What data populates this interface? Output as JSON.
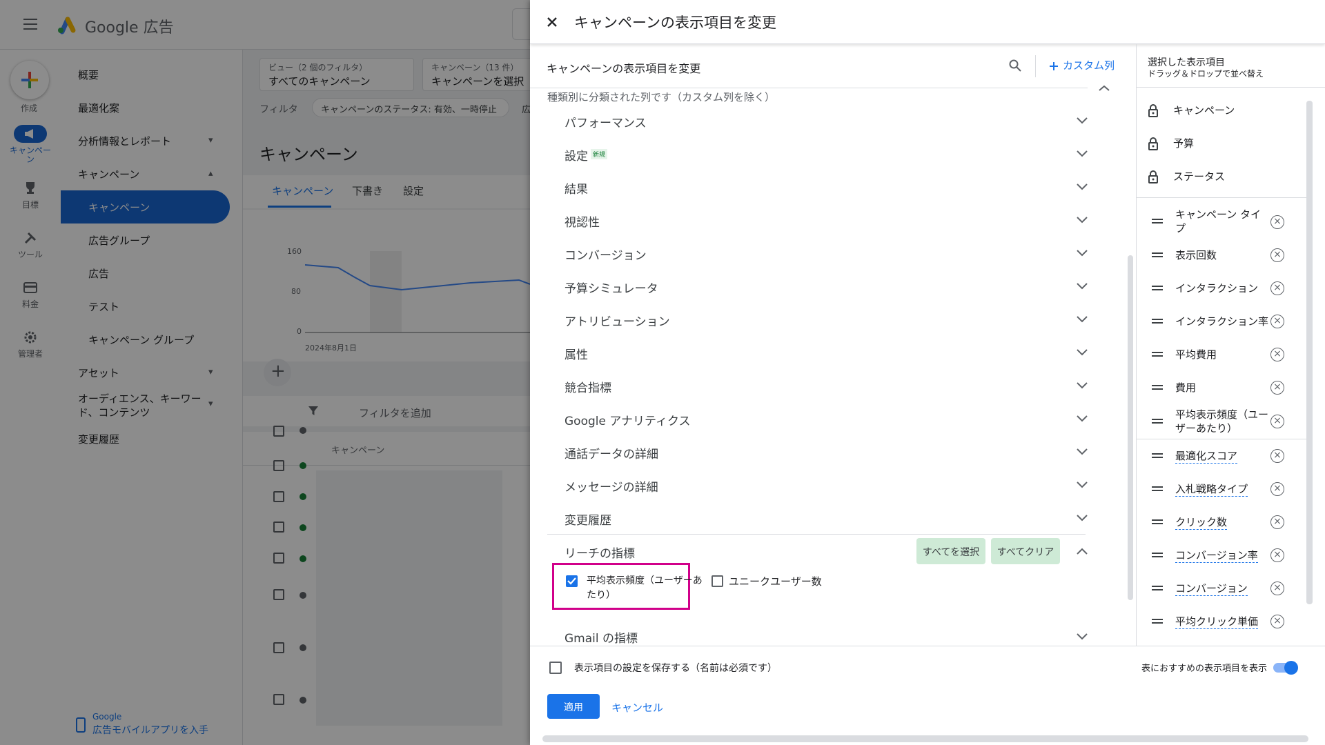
{
  "app": {
    "logo_text": "Google 広告",
    "create_label": "作成",
    "rail": [
      {
        "icon": "campaign-megaphone-icon",
        "label": "キャンペーン"
      },
      {
        "icon": "trophy-icon",
        "label": "目標"
      },
      {
        "icon": "tools-icon",
        "label": "ツール"
      },
      {
        "icon": "billing-card-icon",
        "label": "料金"
      },
      {
        "icon": "gear-icon",
        "label": "管理者"
      }
    ],
    "nav": {
      "overview": "概要",
      "recommendations": "最適化案",
      "insights": "分析情報とレポート",
      "campaigns": "キャンペーン",
      "campaigns_sub": [
        "キャンペーン",
        "広告グループ",
        "広告",
        "テスト",
        "キャンペーン グループ"
      ],
      "assets": "アセット",
      "audiences": "オーディエンス、キーワード、コンテンツ",
      "change_history": "変更履歴",
      "app_promo_brand": "Google",
      "app_promo": "広告モバイルアプリを入手"
    },
    "view_selector": {
      "label": "ビュー（2 個のフィルタ）",
      "value": "すべてのキャンペーン"
    },
    "campaign_selector": {
      "label": "キャンペーン（13 件）",
      "value": "キャンペーンを選択"
    },
    "filter_label": "フィルタ",
    "filter_chip": "キャンペーンのステータス: 有効、一時停止",
    "filter_chip2": "広",
    "page_title": "キャンペーン",
    "tabs": [
      "キャンペーン",
      "下書き",
      "設定"
    ],
    "chart_ticks": [
      "160",
      "80",
      "0"
    ],
    "chart_date": "2024年8月1日",
    "add_filter": "フィルタを追加",
    "table_header": "キャンペーン"
  },
  "panel": {
    "title": "キャンペーンの表示項目を変更",
    "subheader": "キャンペーンの表示項目を変更",
    "custom_column": "カスタム列",
    "section_note": "種類別に分類された列です（カスタム列を除く）",
    "categories": [
      {
        "label": "パフォーマンス"
      },
      {
        "label": "設定",
        "badge": "新規"
      },
      {
        "label": "結果"
      },
      {
        "label": "視認性"
      },
      {
        "label": "コンバージョン"
      },
      {
        "label": "予算シミュレータ"
      },
      {
        "label": "アトリビューション"
      },
      {
        "label": "属性"
      },
      {
        "label": "競合指標"
      },
      {
        "label": "Google アナリティクス"
      },
      {
        "label": "通話データの詳細"
      },
      {
        "label": "メッセージの詳細"
      },
      {
        "label": "変更履歴"
      }
    ],
    "reach": {
      "label": "リーチの指標",
      "select_all": "すべてを選択",
      "clear_all": "すべてクリア",
      "opt1_line1": "平均表示頻度（ユーザーあ",
      "opt1_line2": "たり）",
      "opt2": "ユニークユーザー数"
    },
    "gmail": "Gmail の指標",
    "save_setting": "表示項目の設定を保存する（名前は必須です）",
    "show_recommended": "表におすすめの表示項目を表示",
    "apply": "適用",
    "cancel": "キャンセル",
    "selected": {
      "title": "選択した表示項目",
      "hint": "ドラッグ＆ドロップで並べ替え",
      "locked": [
        "キャンペーン",
        "予算",
        "ステータス"
      ],
      "items": [
        {
          "line1": "キャンペーン タイ",
          "line2": "プ"
        },
        {
          "line1": "表示回数"
        },
        {
          "line1": "インタラクション"
        },
        {
          "line1": "インタラクション率"
        },
        {
          "line1": "平均費用"
        },
        {
          "line1": "費用"
        },
        {
          "line1": "平均表示頻度（ユー",
          "line2": "ザーあたり）"
        }
      ],
      "recommended": [
        "最適化スコア",
        "入札戦略タイプ",
        "クリック数",
        "コンバージョン率",
        "コンバージョン",
        "平均クリック単価"
      ]
    }
  },
  "colors": {
    "accent": "#1a73e8",
    "highlight": "#d1008a",
    "chip_green": "#ceead6"
  }
}
